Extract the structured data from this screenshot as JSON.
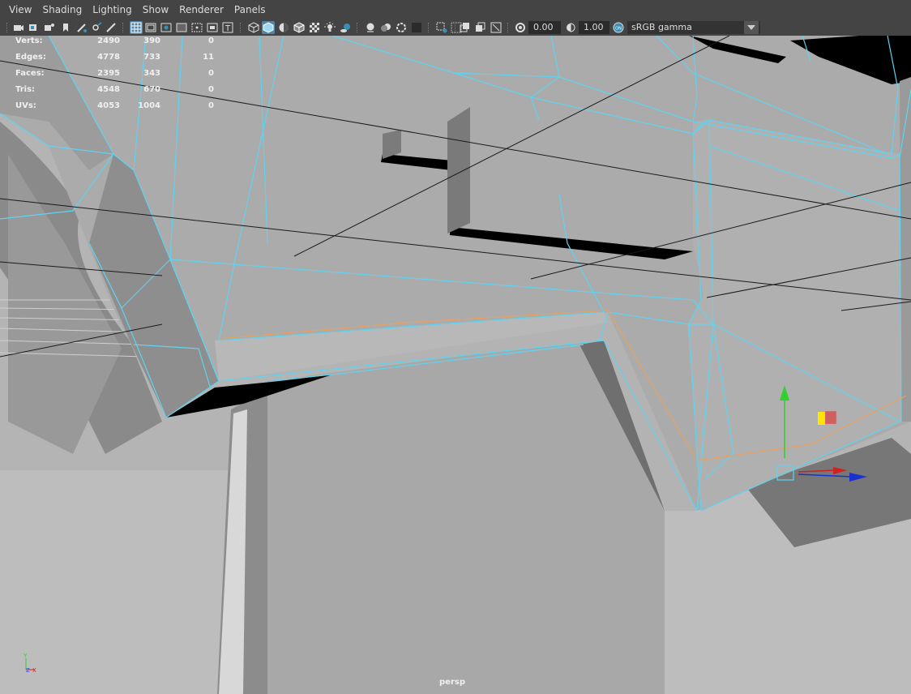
{
  "menu": [
    "View",
    "Shading",
    "Lighting",
    "Show",
    "Renderer",
    "Panels"
  ],
  "toolbar": {
    "exposure": "0.00",
    "gamma": "1.00",
    "color_management_badge": "ON",
    "color_space": "sRGB gamma"
  },
  "hud": {
    "rows": [
      {
        "label": "Verts:",
        "total": "2490",
        "selected": "390",
        "highlighted": "0"
      },
      {
        "label": "Edges:",
        "total": "4778",
        "selected": "733",
        "highlighted": "11"
      },
      {
        "label": "Faces:",
        "total": "2395",
        "selected": "343",
        "highlighted": "0"
      },
      {
        "label": "Tris:",
        "total": "4548",
        "selected": "670",
        "highlighted": "0"
      },
      {
        "label": "UVs:",
        "total": "4053",
        "selected": "1004",
        "highlighted": "0"
      }
    ]
  },
  "camera_name": "persp",
  "axis": {
    "y": "Y",
    "z": "Z",
    "x": "X"
  },
  "colors": {
    "ui_bg": "#444444",
    "highlight": "#5285a6",
    "wireframe": "#5fd3f0",
    "selected_edge": "#e8a060",
    "viewport_bg": "#b5b5b5"
  }
}
